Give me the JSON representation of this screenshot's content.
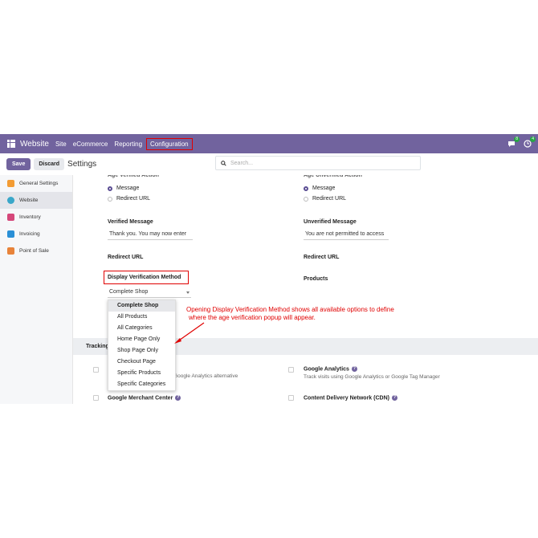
{
  "navbar": {
    "brand": "Website",
    "menu": [
      {
        "label": "Site"
      },
      {
        "label": "eCommerce"
      },
      {
        "label": "Reporting"
      },
      {
        "label": "Configuration"
      }
    ],
    "messages_badge": "8",
    "activity_badge": "4"
  },
  "control_panel": {
    "save_label": "Save",
    "discard_label": "Discard",
    "title": "Settings",
    "search_placeholder": "Search..."
  },
  "sidebar": {
    "items": [
      {
        "label": "General Settings",
        "icon": "gear-icon",
        "color": "#f39c34"
      },
      {
        "label": "Website",
        "icon": "website-icon",
        "color": "#3aa7c9"
      },
      {
        "label": "Inventory",
        "icon": "inventory-icon",
        "color": "#d5477a"
      },
      {
        "label": "Invoicing",
        "icon": "invoicing-icon",
        "color": "#2a8fd6"
      },
      {
        "label": "Point of Sale",
        "icon": "pos-icon",
        "color": "#e8833a"
      }
    ]
  },
  "age": {
    "verified_title": "Age Verified Action",
    "unverified_title": "Age Unverified Action",
    "radio_message": "Message",
    "radio_redirect": "Redirect URL",
    "verified_message_label": "Verified Message",
    "verified_message_value": "Thank you. You may now enter",
    "unverified_message_label": "Unverified Message",
    "unverified_message_value": "You are not permitted to access",
    "redirect_url_label": "Redirect URL",
    "redirect_url_label_right": "Redirect URL",
    "display_method_label": "Display Verification Method",
    "display_method_value": "Complete Shop",
    "products_label": "Products"
  },
  "dropdown": {
    "options": [
      "Complete Shop",
      "All Products",
      "All Categories",
      "Home Page Only",
      "Shop Page Only",
      "Checkout Page",
      "Specific Products",
      "Specific Categories"
    ]
  },
  "tracking": {
    "section_title": "Tracking",
    "left_desc_partial": "y Google Analytics alternative",
    "google_analytics_title": "Google Analytics",
    "google_analytics_desc": "Track visits using Google Analytics or Google Tag Manager",
    "merchant_center_title": "Google Merchant Center",
    "cdn_title": "Content Delivery Network (CDN)"
  },
  "annotation": {
    "line1": "Opening Display Verification Method shows all available options to define",
    "line2": "where the age verification popup will appear."
  },
  "colors": {
    "navbar": "#71639e",
    "highlight": "#e00000"
  }
}
